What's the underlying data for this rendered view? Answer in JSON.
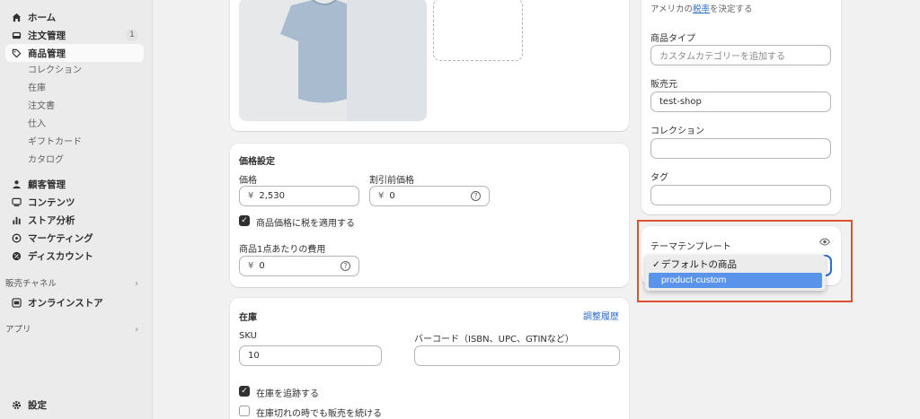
{
  "sidebar": {
    "nav": {
      "home": "ホーム",
      "orders": "注文管理",
      "orders_badge": "1",
      "products": "商品管理",
      "customers": "顧客管理",
      "content": "コンテンツ",
      "analytics": "ストア分析",
      "marketing": "マーケティング",
      "discounts": "ディスカウント",
      "online_store": "オンラインストア",
      "settings": "設定"
    },
    "product_sub": [
      "コレクション",
      "在庫",
      "注文書",
      "仕入",
      "ギフトカード",
      "カタログ"
    ],
    "sales_channels_label": "販売チャネル",
    "apps_label": "アプリ"
  },
  "pricing": {
    "title": "価格設定",
    "price_label": "価格",
    "price_currency": "¥",
    "price_value": "2,530",
    "compare_label": "割引前価格",
    "compare_currency": "¥",
    "compare_value": "0",
    "tax_checkbox_label": "商品価格に税を適用する",
    "cost_label": "商品1点あたりの費用",
    "cost_currency": "¥",
    "cost_value": "0"
  },
  "inventory": {
    "title": "在庫",
    "history_link": "調整履歴",
    "sku_label": "SKU",
    "sku_value": "10",
    "barcode_label": "バーコード（ISBN、UPC、GTINなど）",
    "barcode_value": "",
    "track_label": "在庫を追跡する",
    "continue_label": "在庫切れの時でも販売を続ける"
  },
  "organization": {
    "tax_note_prefix": "アメリカの",
    "tax_note_link": "税率",
    "tax_note_suffix": "を決定する",
    "product_type_label": "商品タイプ",
    "product_type_placeholder": "カスタムカテゴリーを追加する",
    "vendor_label": "販売元",
    "vendor_value": "test-shop",
    "collections_label": "コレクション",
    "collections_value": "",
    "tags_label": "タグ",
    "tags_value": ""
  },
  "theme_template": {
    "title": "テーマテンプレート",
    "options": [
      "デフォルトの商品",
      "product-custom"
    ],
    "checked_option": "デフォルトの商品",
    "highlighted_option": "product-custom"
  },
  "colors": {
    "accent_link": "#2c6ecb",
    "highlight_border": "#d9532e",
    "dropdown_selection": "#5a93ea"
  }
}
